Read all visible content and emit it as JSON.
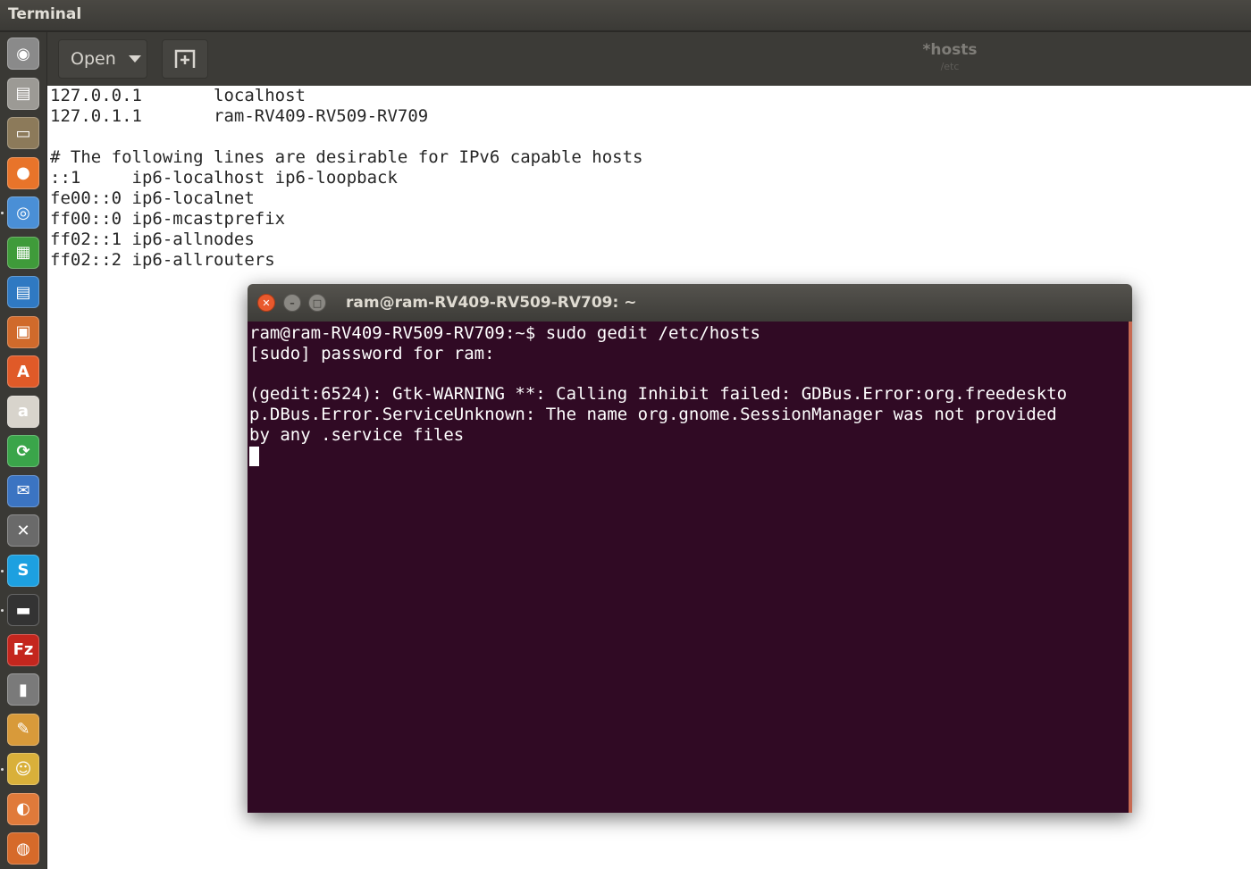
{
  "top_panel": {
    "app_title": "Terminal"
  },
  "launcher": {
    "items": [
      {
        "name": "dash-home-icon",
        "glyph": "◉",
        "color": "#8a8a8a"
      },
      {
        "name": "files-icon",
        "glyph": "▤",
        "color": "#9c9a95"
      },
      {
        "name": "archive-manager-icon",
        "glyph": "▭",
        "color": "#8c7a5a"
      },
      {
        "name": "firefox-icon",
        "glyph": "●",
        "color": "#e8742a"
      },
      {
        "name": "chromium-icon",
        "glyph": "◎",
        "color": "#4a8fd6"
      },
      {
        "name": "libreoffice-calc-icon",
        "glyph": "▦",
        "color": "#3f9b3a"
      },
      {
        "name": "libreoffice-writer-icon",
        "glyph": "▤",
        "color": "#2f79c2"
      },
      {
        "name": "libreoffice-impress-icon",
        "glyph": "▣",
        "color": "#d06a2b"
      },
      {
        "name": "software-center-icon",
        "glyph": "A",
        "color": "#e05a28"
      },
      {
        "name": "amazon-icon",
        "glyph": "a",
        "color": "#d8d4cc"
      },
      {
        "name": "update-manager-icon",
        "glyph": "⟳",
        "color": "#3aa54a"
      },
      {
        "name": "thunderbird-icon",
        "glyph": "✉",
        "color": "#3b74c2"
      },
      {
        "name": "system-settings-icon",
        "glyph": "✕",
        "color": "#6a6a6a"
      },
      {
        "name": "skype-icon",
        "glyph": "S",
        "color": "#1da0e0"
      },
      {
        "name": "terminal-icon",
        "glyph": "▬",
        "color": "#333333"
      },
      {
        "name": "filezilla-icon",
        "glyph": "Fz",
        "color": "#c4261e"
      },
      {
        "name": "media-player-icon",
        "glyph": "▮",
        "color": "#7a7a7a"
      },
      {
        "name": "text-editor-icon",
        "glyph": "✎",
        "color": "#d89a3a"
      },
      {
        "name": "gimp-icon",
        "glyph": "☺",
        "color": "#d9b03a"
      },
      {
        "name": "app-orange-icon",
        "glyph": "◐",
        "color": "#e07a3a"
      },
      {
        "name": "app-firefox-dev-icon",
        "glyph": "◍",
        "color": "#d66a2a"
      }
    ]
  },
  "gedit": {
    "open_label": "Open",
    "doc_title": "*hosts",
    "doc_path": "/etc",
    "lines": [
      "127.0.0.1       localhost",
      "127.0.1.1       ram-RV409-RV509-RV709",
      "",
      "# The following lines are desirable for IPv6 capable hosts",
      "::1     ip6-localhost ip6-loopback",
      "fe00::0 ip6-localnet",
      "ff00::0 ip6-mcastprefix",
      "ff02::1 ip6-allnodes",
      "ff02::2 ip6-allrouters"
    ]
  },
  "terminal": {
    "title": "ram@ram-RV409-RV509-RV709: ~",
    "lines": [
      "ram@ram-RV409-RV509-RV709:~$ sudo gedit /etc/hosts",
      "[sudo] password for ram:",
      "",
      "(gedit:6524): Gtk-WARNING **: Calling Inhibit failed: GDBus.Error:org.freedeskto",
      "p.DBus.Error.ServiceUnknown: The name org.gnome.SessionManager was not provided",
      "by any .service files"
    ],
    "close_glyph": "✕",
    "minimize_glyph": "–",
    "maximize_glyph": "□"
  }
}
